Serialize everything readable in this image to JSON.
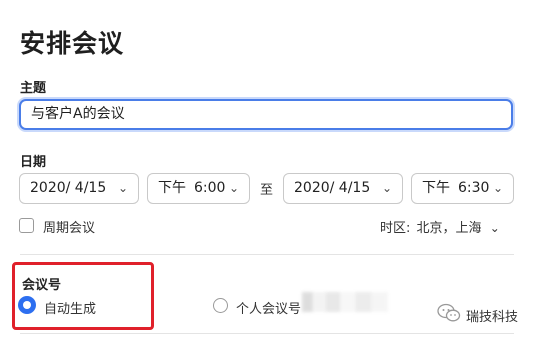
{
  "page": {
    "title": "安排会议"
  },
  "topic": {
    "label": "主题",
    "value": "与客户A的会议"
  },
  "date": {
    "label": "日期",
    "start_date": "2020/ 4/15",
    "start_ampm": "下午",
    "start_time": "6:00",
    "separator": "至",
    "end_date": "2020/ 4/15",
    "end_ampm": "下午",
    "end_time": "6:30"
  },
  "recurring": {
    "label": "周期会议",
    "checked": false
  },
  "timezone": {
    "label": "时区:",
    "value": "北京，上海"
  },
  "meeting_id": {
    "label": "会议号",
    "options": [
      {
        "label": "自动生成",
        "selected": true
      },
      {
        "label": "个人会议号",
        "selected": false
      }
    ]
  },
  "watermark": {
    "text": "瑞技科技"
  },
  "icons": {
    "dropdown": "chevron-down-icon",
    "watermark": "wechat-icon"
  },
  "colors": {
    "accent": "#2d6ff0",
    "focus_ring": "#4a7de8",
    "annotation": "#e0202a"
  }
}
